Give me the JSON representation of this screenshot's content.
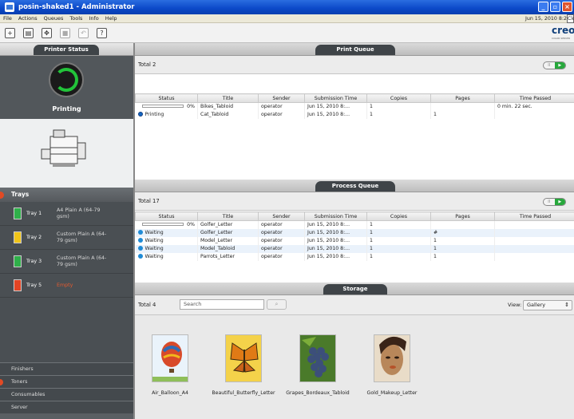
{
  "window": {
    "title": "posin-shaked1 - Administrator"
  },
  "menu": {
    "items": [
      "File",
      "Actions",
      "Queues",
      "Tools",
      "Info",
      "Help"
    ],
    "datetime": "Jun 15, 2010 8:2",
    "clock": "Clo"
  },
  "brand": {
    "logo": "creo",
    "tagline": "COLOR SERVER"
  },
  "left": {
    "printer_status_tab": "Printer Status",
    "status": "Printing",
    "trays_header": "Trays",
    "trays": [
      {
        "name": "Tray 1",
        "desc": "A4 Plain A (64-79 gsm)",
        "color": "#2fb04a"
      },
      {
        "name": "Tray 2",
        "desc": "Custom Plain A (64-79 gsm)",
        "color": "#f0c419"
      },
      {
        "name": "Tray 3",
        "desc": "Custom Plain A (64-79 gsm)",
        "color": "#2fb04a"
      },
      {
        "name": "Tray 5",
        "desc": "Empty",
        "color": "#e34424"
      }
    ],
    "sections": [
      "Finishers",
      "Toners",
      "Consumables",
      "Server"
    ]
  },
  "print_queue": {
    "tab": "Print Queue",
    "total": "Total 2",
    "toggle": [
      "II",
      "▶"
    ],
    "columns": [
      "Status",
      "Title",
      "Sender",
      "Submission Time",
      "Copies",
      "Pages",
      "Time Passed"
    ],
    "rows": [
      {
        "status": "0%",
        "title": "Bikes_Tabloid",
        "sender": "operator",
        "time": "Jun 15, 2010 8:...",
        "copies": "1",
        "pages": "",
        "passed": "0 min. 22 sec."
      },
      {
        "status": "Printing",
        "title": "Cat_Tabloid",
        "sender": "operator",
        "time": "Jun 15, 2010 8:...",
        "copies": "1",
        "pages": "1",
        "passed": ""
      }
    ]
  },
  "process_queue": {
    "tab": "Process Queue",
    "total": "Total 17",
    "toggle": [
      "II",
      "▶"
    ],
    "columns": [
      "Status",
      "Title",
      "Sender",
      "Submission Time",
      "Copies",
      "Pages",
      "Time Passed"
    ],
    "rows": [
      {
        "status": "0%",
        "title": "Golfer_Letter",
        "sender": "operator",
        "time": "Jun 15, 2010 8:...",
        "copies": "1",
        "pages": "",
        "passed": ""
      },
      {
        "status": "Waiting",
        "title": "Golfer_Letter",
        "sender": "operator",
        "time": "Jun 15, 2010 8:...",
        "copies": "1",
        "pages": "#",
        "passed": ""
      },
      {
        "status": "Waiting",
        "title": "Model_Letter",
        "sender": "operator",
        "time": "Jun 15, 2010 8:...",
        "copies": "1",
        "pages": "1",
        "passed": ""
      },
      {
        "status": "Waiting",
        "title": "Model_Tabloid",
        "sender": "operator",
        "time": "Jun 15, 2010 8:...",
        "copies": "1",
        "pages": "1",
        "passed": ""
      },
      {
        "status": "Waiting",
        "title": "Parrots_Letter",
        "sender": "operator",
        "time": "Jun 15, 2010 8:...",
        "copies": "1",
        "pages": "1",
        "passed": ""
      }
    ]
  },
  "storage": {
    "tab": "Storage",
    "total": "Total 4",
    "search_placeholder": "Search",
    "view_label": "View:",
    "view_value": "Gallery",
    "items": [
      {
        "label": "Air_Balloon_A4",
        "color": "#d84a2a"
      },
      {
        "label": "Beautiful_Butterfly_Letter",
        "color": "#e89a1a"
      },
      {
        "label": "Grapes_Bordeaux_Tabloid",
        "color": "#3c4f7a"
      },
      {
        "label": "Gold_Makeup_Letter",
        "color": "#b8875a"
      }
    ]
  }
}
